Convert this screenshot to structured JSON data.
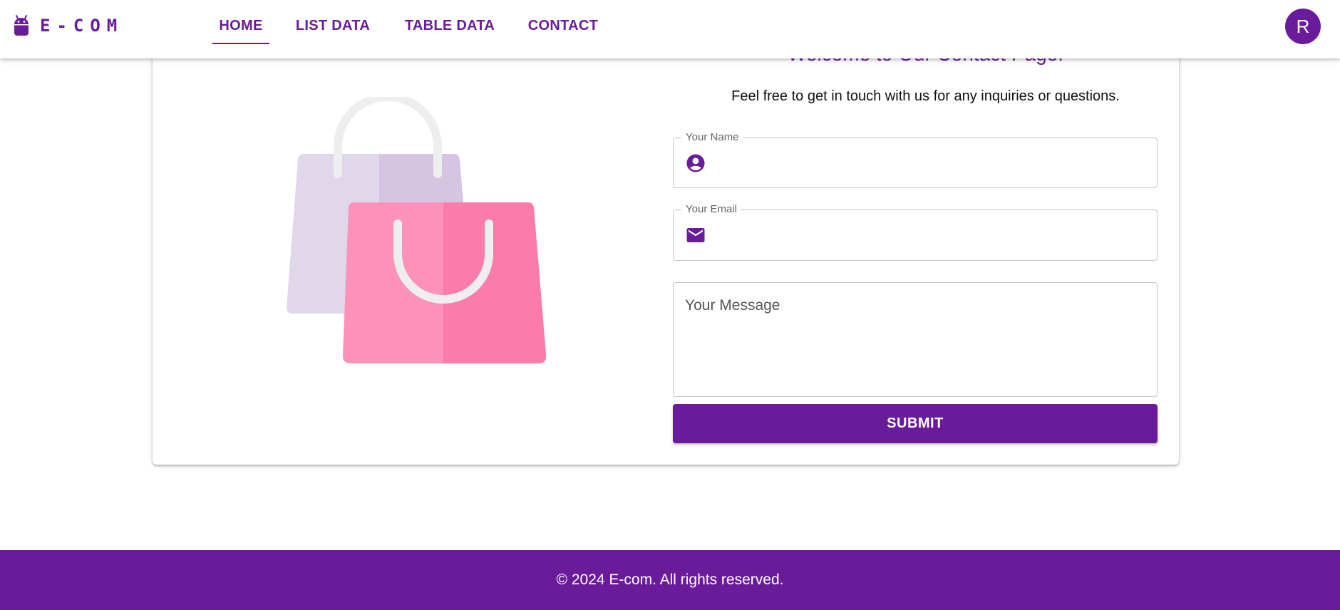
{
  "brand": {
    "name": "E-COM",
    "icon": "android-icon"
  },
  "nav": {
    "items": [
      {
        "label": "HOME",
        "active": true
      },
      {
        "label": "LIST DATA",
        "active": false
      },
      {
        "label": "TABLE DATA",
        "active": false
      },
      {
        "label": "CONTACT",
        "active": false
      }
    ]
  },
  "user": {
    "avatar_letter": "R"
  },
  "contact": {
    "title": "Welcome to Our Contact Page!",
    "subtitle": "Feel free to get in touch with us for any inquiries or questions.",
    "illustration": "shopping-bags-illustration",
    "fields": {
      "name": {
        "label": "Your Name",
        "icon": "account-circle-icon",
        "value": ""
      },
      "email": {
        "label": "Your Email",
        "icon": "mail-icon",
        "value": ""
      },
      "message": {
        "placeholder": "Your Message",
        "value": ""
      }
    },
    "submit_label": "SUBMIT"
  },
  "footer": {
    "text": "© 2024 E-com. All rights reserved."
  },
  "colors": {
    "primary": "#6a1b9a",
    "bag_back": "#e1d7ea",
    "bag_back_shade": "#d5c5e2",
    "bag_front": "#fc92b9",
    "bag_front_shade": "#fb7bab",
    "handle": "#eeeeee"
  }
}
